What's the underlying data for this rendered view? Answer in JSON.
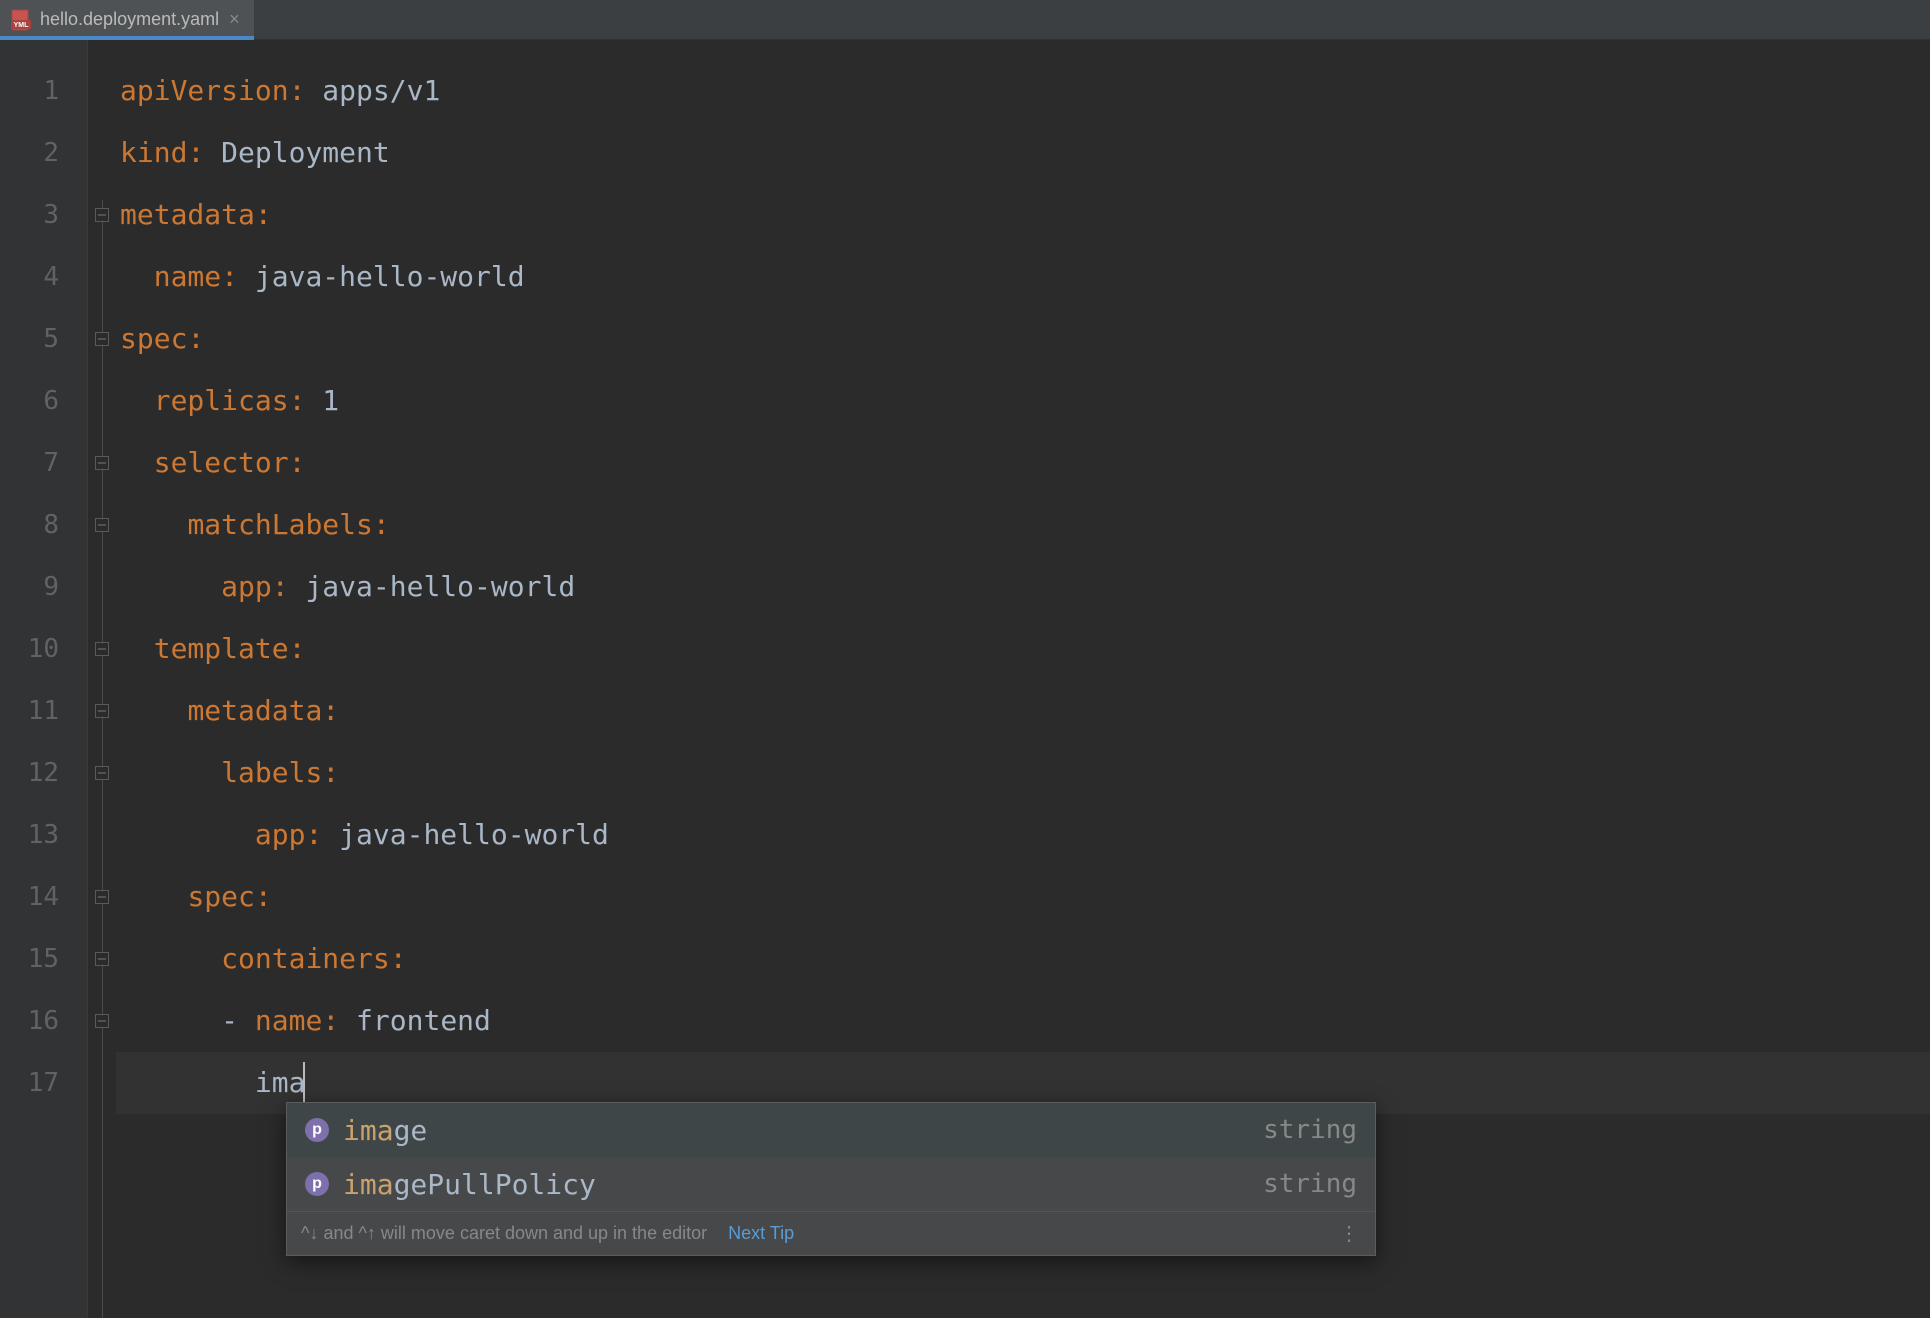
{
  "tab": {
    "filename": "hello.deployment.yaml",
    "icon_label": "YML"
  },
  "code": {
    "lines": [
      {
        "n": 1,
        "indent": "",
        "key": "apiVersion",
        "val": "apps/v1",
        "fold": ""
      },
      {
        "n": 2,
        "indent": "",
        "key": "kind",
        "val": "Deployment",
        "fold": ""
      },
      {
        "n": 3,
        "indent": "",
        "key": "metadata",
        "val": "",
        "fold": "open"
      },
      {
        "n": 4,
        "indent": "  ",
        "key": "name",
        "val": "java-hello-world",
        "fold": "mid"
      },
      {
        "n": 5,
        "indent": "",
        "key": "spec",
        "val": "",
        "fold": "open"
      },
      {
        "n": 6,
        "indent": "  ",
        "key": "replicas",
        "val": "1",
        "fold": "mid"
      },
      {
        "n": 7,
        "indent": "  ",
        "key": "selector",
        "val": "",
        "fold": "open"
      },
      {
        "n": 8,
        "indent": "    ",
        "key": "matchLabels",
        "val": "",
        "fold": "open"
      },
      {
        "n": 9,
        "indent": "      ",
        "key": "app",
        "val": "java-hello-world",
        "fold": "mid"
      },
      {
        "n": 10,
        "indent": "  ",
        "key": "template",
        "val": "",
        "fold": "open"
      },
      {
        "n": 11,
        "indent": "    ",
        "key": "metadata",
        "val": "",
        "fold": "open"
      },
      {
        "n": 12,
        "indent": "      ",
        "key": "labels",
        "val": "",
        "fold": "open"
      },
      {
        "n": 13,
        "indent": "        ",
        "key": "app",
        "val": "java-hello-world",
        "fold": "mid"
      },
      {
        "n": 14,
        "indent": "    ",
        "key": "spec",
        "val": "",
        "fold": "open"
      },
      {
        "n": 15,
        "indent": "      ",
        "key": "containers",
        "val": "",
        "fold": "open"
      },
      {
        "n": 16,
        "indent": "      ",
        "dash": true,
        "key": "name",
        "val": "frontend",
        "fold": "open"
      },
      {
        "n": 17,
        "indent": "        ",
        "raw": "ima",
        "current": true,
        "fold": "mid"
      }
    ]
  },
  "completion": {
    "items": [
      {
        "match": "ima",
        "rest": "ge",
        "type": "string",
        "selected": true
      },
      {
        "match": "ima",
        "rest": "gePullPolicy",
        "type": "string",
        "selected": false
      }
    ],
    "footer_hint": "^↓ and ^↑ will move caret down and up in the editor",
    "footer_link": "Next Tip",
    "icon_letter": "p"
  }
}
